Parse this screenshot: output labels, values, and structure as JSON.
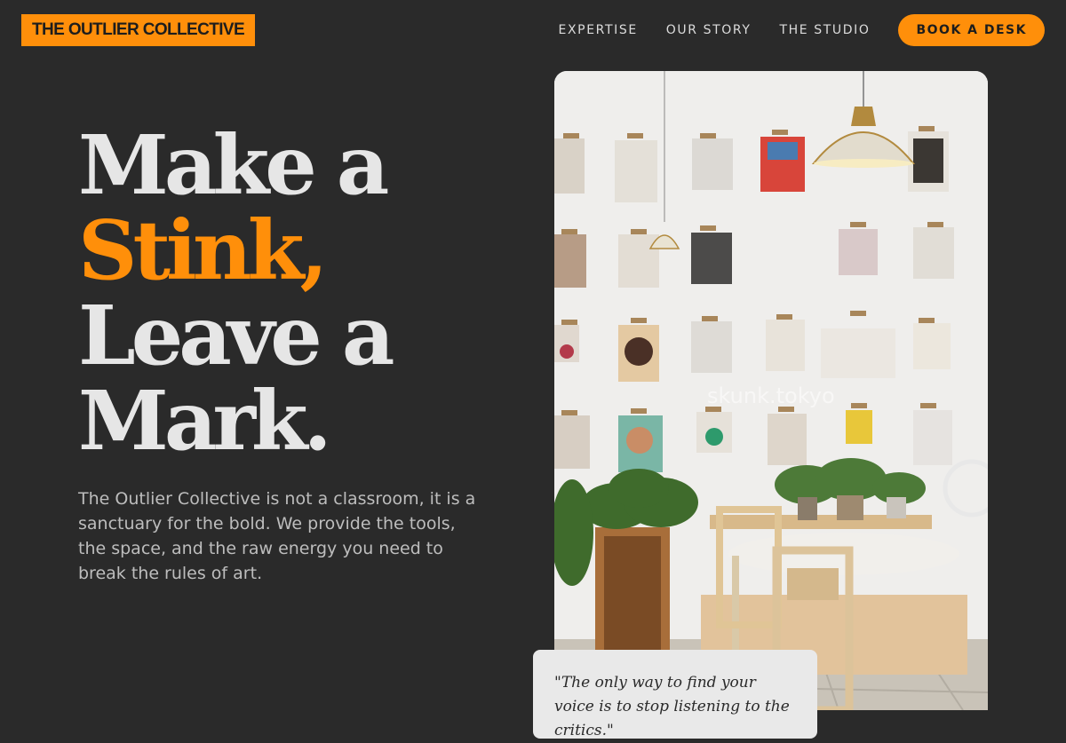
{
  "brand": {
    "name": "THE OUTLIER COLLECTIVE"
  },
  "nav": {
    "links": [
      "EXPERTISE",
      "OUR STORY",
      "THE STUDIO"
    ],
    "cta": "BOOK A DESK"
  },
  "hero": {
    "headline": [
      "Make a",
      "Stink,",
      "Leave a",
      "Mark."
    ],
    "lead": "The Outlier Collective is not a classroom, it is a sanctuary for the bold. We provide the tools, the space, and the raw energy you need to break the rules of art."
  },
  "photo": {
    "watermark": "skunk.tokyo"
  },
  "quote": {
    "text": "\"The only way to find your voice is to stop listening to the critics.\""
  },
  "colors": {
    "accent": "#ff8f0a",
    "background": "#2a2a2a"
  }
}
